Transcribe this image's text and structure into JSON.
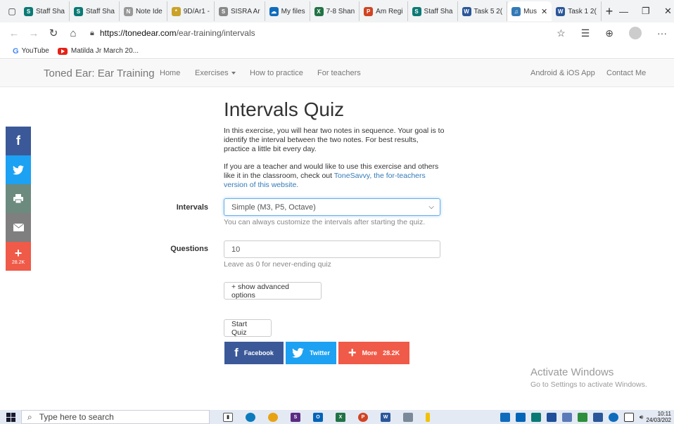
{
  "browser": {
    "tabs": [
      {
        "label": "Staff Sha",
        "color": "#0b7a75",
        "glyph": "S"
      },
      {
        "label": "Staff Sha",
        "color": "#0b7a75",
        "glyph": "S"
      },
      {
        "label": "Note Ide",
        "color": "#999999",
        "glyph": "N"
      },
      {
        "label": "9D/Ar1 -",
        "color": "#c9a227",
        "glyph": "*"
      },
      {
        "label": "SISRA Ar",
        "color": "#888888",
        "glyph": "S"
      },
      {
        "label": "My files",
        "color": "#0f6cbd",
        "glyph": "☁"
      },
      {
        "label": "7-8 Shan",
        "color": "#217346",
        "glyph": "X"
      },
      {
        "label": "Am Regi",
        "color": "#d04423",
        "glyph": "P"
      },
      {
        "label": "Staff Sha",
        "color": "#0b7a75",
        "glyph": "S"
      },
      {
        "label": "Task 5 2(",
        "color": "#2b579a",
        "glyph": "W"
      },
      {
        "label": "Mus",
        "color": "#337ab7",
        "glyph": "♫",
        "active": true
      },
      {
        "label": "Task 1 2(",
        "color": "#2b579a",
        "glyph": "W"
      }
    ],
    "new_tab": "+",
    "url_host": "https://tonedear.com",
    "url_path": "/ear-training/intervals",
    "bookmarks": [
      {
        "label": "YouTube",
        "icon": "google-g"
      },
      {
        "label": "Matilda Jr March 20...",
        "icon": "youtube"
      }
    ]
  },
  "site": {
    "brand": "Toned Ear: Ear Training",
    "nav": {
      "home": "Home",
      "exercises": "Exercises",
      "how": "How to practice",
      "teachers": "For teachers",
      "app": "Android & iOS App",
      "contact": "Contact Me"
    }
  },
  "social": {
    "count": "28.2K",
    "colors": {
      "facebook": "#3b5998",
      "twitter": "#1da1f2",
      "print": "#6d8a7f",
      "email": "#7f7f7f",
      "more": "#f05a48"
    }
  },
  "quiz": {
    "title": "Intervals Quiz",
    "intro": "In this exercise, you will hear two notes in sequence. Your goal is to identify the interval between the two notes. For best results, practice a little bit every day.",
    "teacher_pre": "If you are a teacher and would like to use this exercise and others like it in the classroom, check out ",
    "teacher_link": "ToneSavvy, the for-teachers version of this website.",
    "intervals_label": "Intervals",
    "intervals_value": "Simple (M3, P5, Octave)",
    "intervals_help": "You can always customize the intervals after starting the quiz.",
    "questions_label": "Questions",
    "questions_value": "10",
    "questions_help": "Leave as 0 for never-ending quiz",
    "advanced_button": "+ show advanced options",
    "start_button": "Start Quiz"
  },
  "share": {
    "facebook": "Facebook",
    "twitter": "Twitter",
    "more": "More",
    "more_count": "28.2K"
  },
  "watermark": {
    "line1": "Activate Windows",
    "line2": "Go to Settings to activate Windows."
  },
  "taskbar": {
    "search_placeholder": "Type here to search",
    "time": "10:11",
    "date": "24/03/202"
  }
}
